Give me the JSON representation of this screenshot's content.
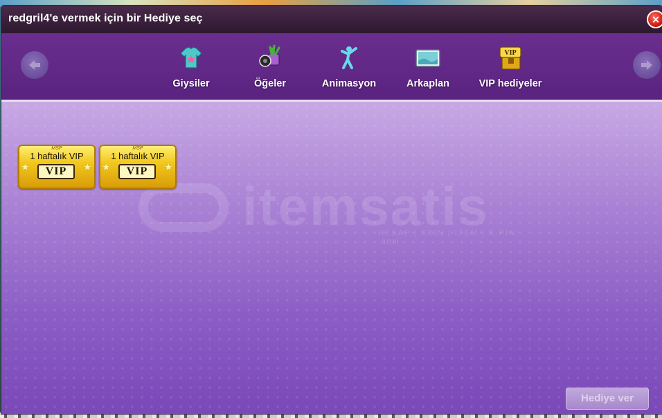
{
  "dialog": {
    "title": "redgril4'e vermek için bir Hediye seç",
    "close_label": "×"
  },
  "tabs": [
    {
      "label": "Giysiler",
      "icon": "tshirt-icon"
    },
    {
      "label": "Öğeler",
      "icon": "items-icon"
    },
    {
      "label": "Animasyon",
      "icon": "dancer-icon"
    },
    {
      "label": "Arkaplan",
      "icon": "background-icon"
    },
    {
      "label": "VIP hediyeler",
      "icon": "vip-chest-icon"
    }
  ],
  "gifts": [
    {
      "brand": "MSP",
      "label": "1 haftalık VIP",
      "badge": "VIP"
    },
    {
      "brand": "MSP",
      "label": "1 haftalık VIP",
      "badge": "VIP"
    }
  ],
  "watermark": {
    "text": "itemsatis",
    "subtext": "HESAP | SKIN | ITEM | E-PIN .com"
  },
  "footer": {
    "give_label": "Hediye ver"
  },
  "colors": {
    "titlebar": "#2d1830",
    "tabbar": "#5a2380",
    "content": "#8a5cc4",
    "ticket_gold": "#f2c81e",
    "close": "#c8140a"
  }
}
